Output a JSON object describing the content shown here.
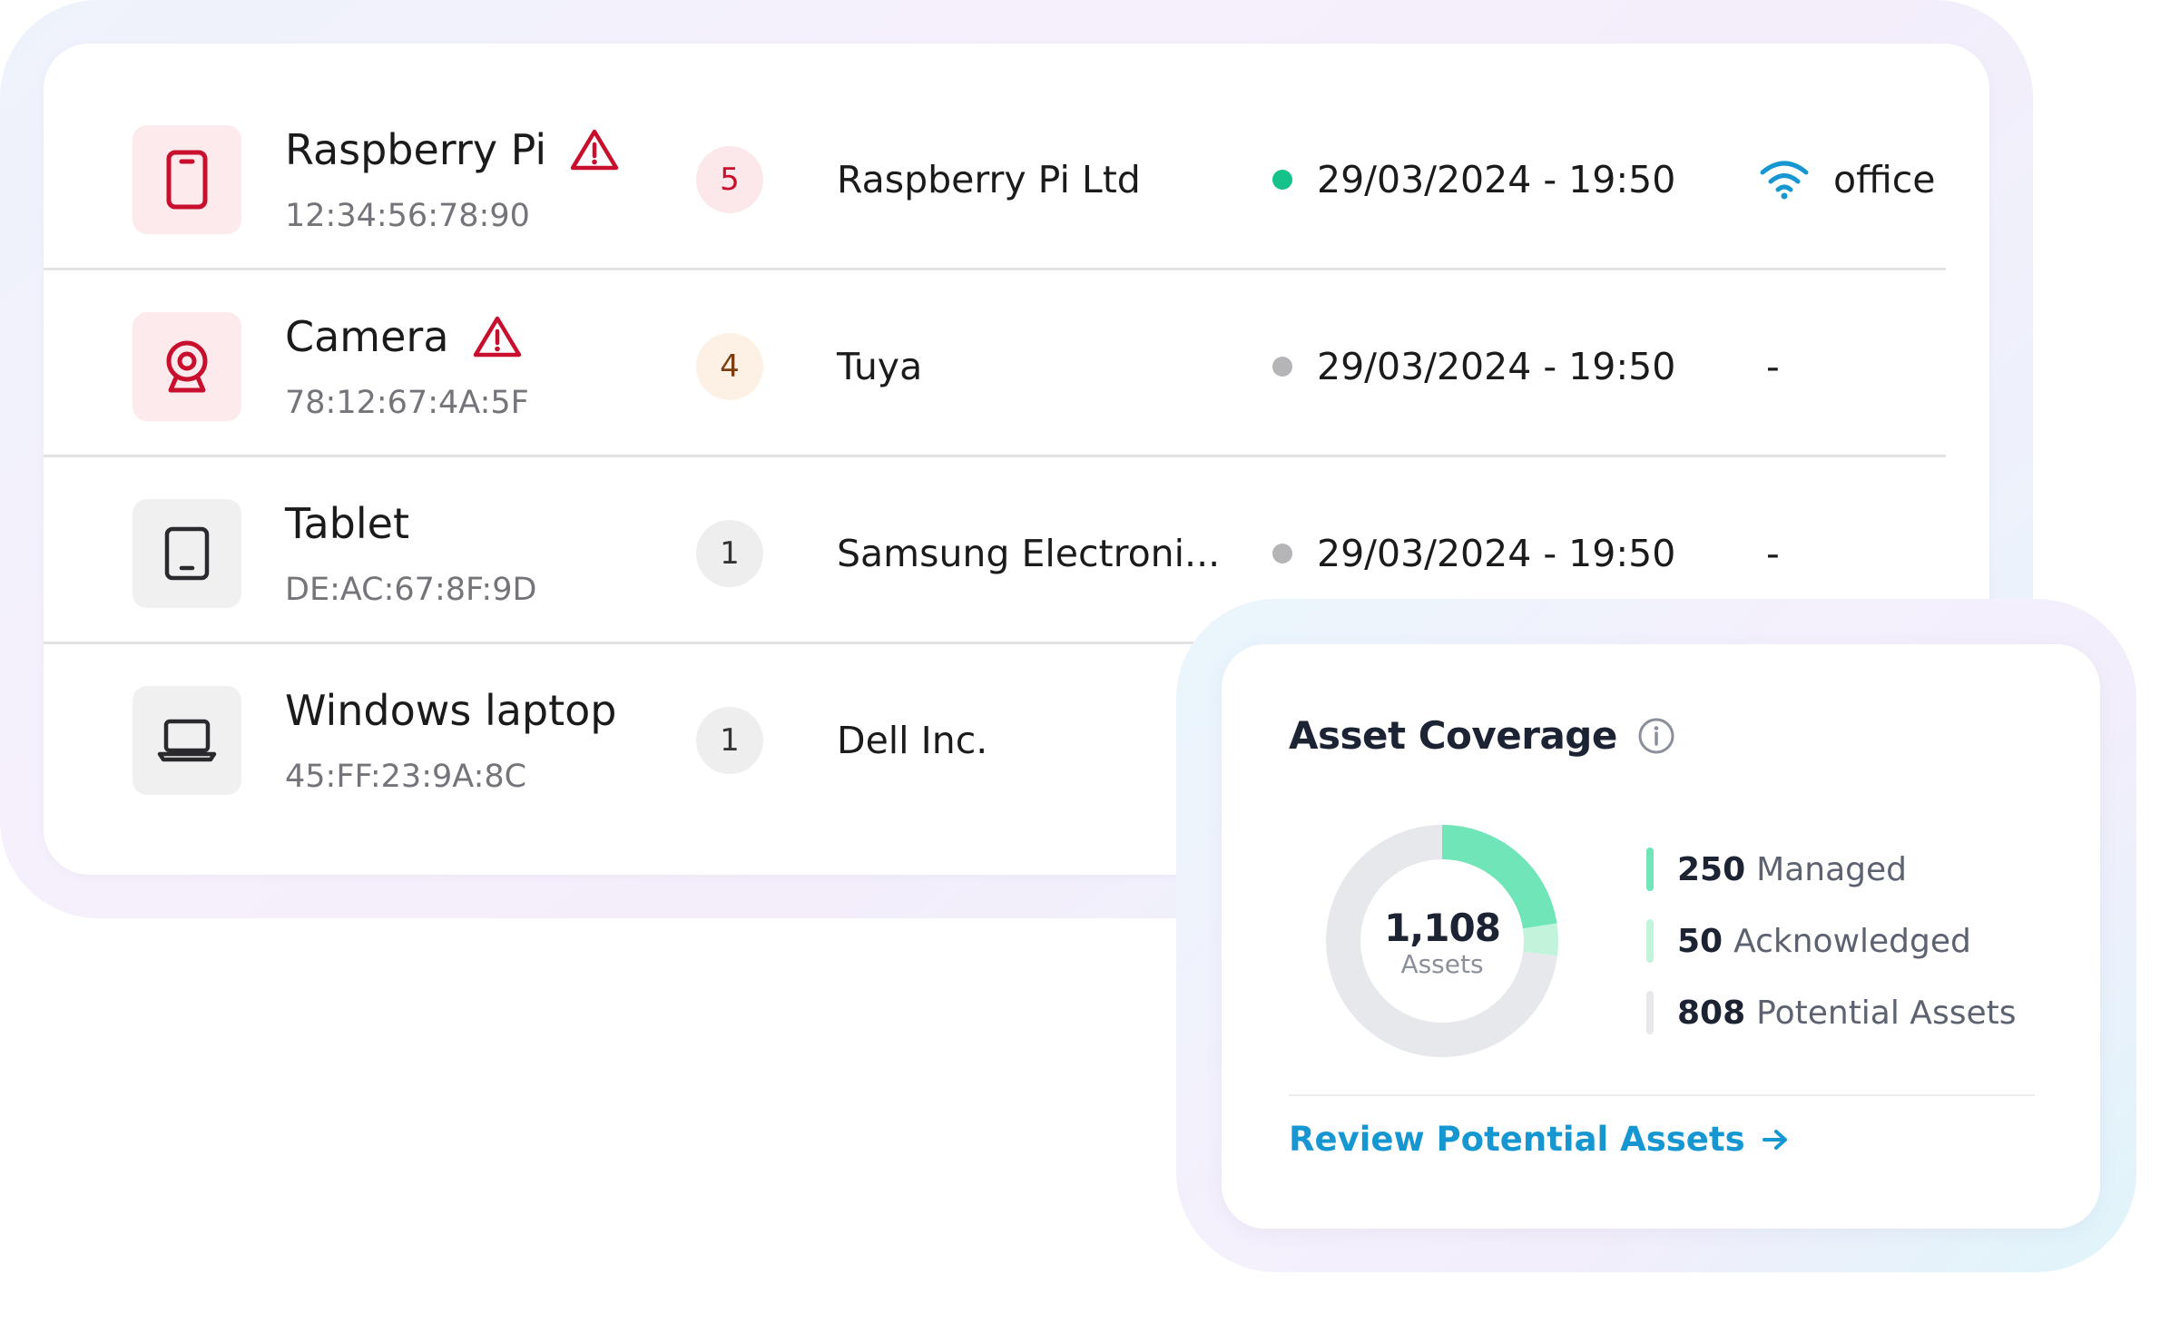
{
  "devices": [
    {
      "name": "Raspberry Pi",
      "mac": "12:34:56:78:90",
      "icon": "phone-icon",
      "alert": true,
      "count": "5",
      "vendor": "Raspberry Pi Ltd",
      "online": true,
      "timestamp": "29/03/2024 - 19:50",
      "network": "office"
    },
    {
      "name": "Camera",
      "mac": "78:12:67:4A:5F",
      "icon": "webcam-icon",
      "alert": true,
      "count": "4",
      "vendor": "Tuya",
      "online": false,
      "timestamp": "29/03/2024 - 19:50",
      "network": "-"
    },
    {
      "name": "Tablet",
      "mac": "DE:AC:67:8F:9D",
      "icon": "tablet-icon",
      "alert": false,
      "count": "1",
      "vendor": "Samsung Electroni...",
      "online": false,
      "timestamp": "29/03/2024 - 19:50",
      "network": "-"
    },
    {
      "name": "Windows laptop",
      "mac": "45:FF:23:9A:8C",
      "icon": "laptop-icon",
      "alert": false,
      "count": "1",
      "vendor": "Dell Inc."
    }
  ],
  "colors": {
    "alert_red": "#c8102e",
    "online_green": "#15c28a",
    "offline_gray": "#b5b5b8",
    "wifi_blue": "#1697d2",
    "managed_green": "#6fe5b8",
    "acknowledged_green": "#c2f4dc",
    "potential_gray": "#e7e8eb",
    "link_blue": "#1697d2"
  },
  "coverage": {
    "title": "Asset Coverage",
    "total": "1,108",
    "total_label": "Assets",
    "legend": [
      {
        "value": 250,
        "label": "Managed"
      },
      {
        "value": 50,
        "label": "Acknowledged"
      },
      {
        "value": 808,
        "label": "Potential Assets"
      }
    ],
    "link_label": "Review Potential Assets"
  },
  "chart_data": {
    "type": "pie",
    "categories": [
      "Managed",
      "Acknowledged",
      "Potential Assets"
    ],
    "values": [
      250,
      50,
      808
    ],
    "title": "Asset Coverage",
    "center_value": "1,108",
    "center_label": "Assets"
  }
}
